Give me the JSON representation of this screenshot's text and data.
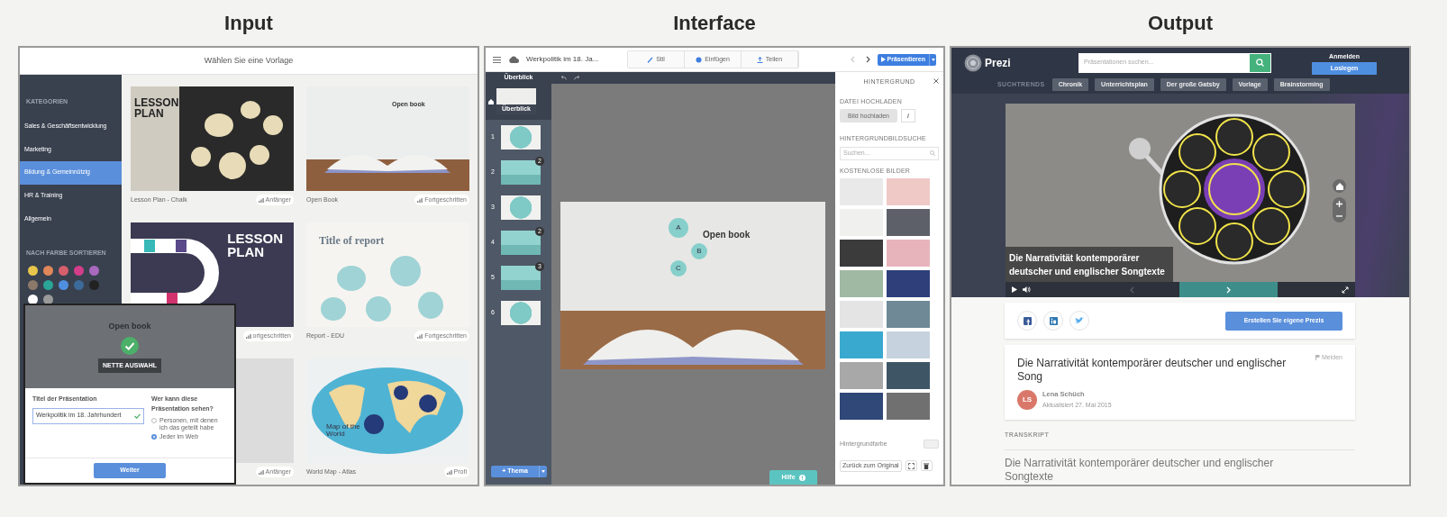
{
  "input": {
    "heading": "Input",
    "title": "Wählen Sie eine Vorlage",
    "categories_heading": "KATEGORIEN",
    "categories": [
      {
        "label": "Sales & Geschäftsentwicklung",
        "selected": false
      },
      {
        "label": "Marketing",
        "selected": false
      },
      {
        "label": "Bildung & Gemeinnützig",
        "selected": true
      },
      {
        "label": "HR & Training",
        "selected": false
      },
      {
        "label": "Allgemein",
        "selected": false
      }
    ],
    "color_heading": "NACH FARBE SORTIEREN",
    "colors": [
      {
        "color": "#e8c64b"
      },
      {
        "color": "#e0875a"
      },
      {
        "color": "#d65f6b"
      },
      {
        "color": "#d33d8a"
      },
      {
        "color": "#a869bf"
      },
      {
        "color": "#8b7869"
      },
      {
        "color": "#2aa598"
      },
      {
        "color": "#4f8fe0"
      },
      {
        "color": "#3c6a99"
      },
      {
        "color": "#222222"
      },
      {
        "color": "#ffffff"
      },
      {
        "color": "#9a9a9a"
      }
    ],
    "template_rows": [
      {
        "templates": [
          {
            "kind": "chalk",
            "preview_text": "LESSON PLAN",
            "name": "Lesson Plan - Chalk",
            "level": "Anfänger"
          },
          {
            "kind": "book",
            "preview_text": "Open book",
            "name": "Open Book",
            "level": "Fortgeschritten"
          }
        ]
      },
      {
        "templates": [
          {
            "kind": "board",
            "preview_text": "LESSON PLAN",
            "level": "ortgeschritten"
          },
          {
            "kind": "report",
            "preview_text": "Title of report",
            "name": "Report - EDU",
            "level": "Fortgeschritten"
          }
        ]
      },
      {
        "templates": [
          {
            "kind": "blank",
            "level": "Anfänger"
          },
          {
            "kind": "map",
            "preview_text": "Map of the World",
            "name": "World Map - Atlas",
            "level": "Profi"
          }
        ]
      }
    ],
    "dialog": {
      "preview_text": "Open book",
      "tag": "NETTE AUSWAHL",
      "title_label": "Titel der Präsentation",
      "title_value": "Werkpolitik im 18. Jahrhundert",
      "visibility_label": "Wer kann diese Präsentation sehen?",
      "visibility_options": [
        {
          "label": "Personen, mit denen ich das geteilt habe",
          "selected": false
        },
        {
          "label": "Jeder im Web",
          "selected": true
        }
      ],
      "button": "Weiter"
    }
  },
  "interface": {
    "heading": "Interface",
    "title": "Werkpolitik im 18. Ja...",
    "tools": [
      {
        "kind": "style",
        "label": "Stil"
      },
      {
        "kind": "insert",
        "label": "Einfügen"
      },
      {
        "kind": "share",
        "label": "Teilen"
      }
    ],
    "present_button": "Präsentieren",
    "outline_heading": "Überblick",
    "overview": {
      "label": "Überblick",
      "selected": true
    },
    "slides": [
      {
        "number": "1",
        "kind": "circle",
        "selected": false
      },
      {
        "number": "2",
        "kind": "teal",
        "badge": "2",
        "selected": false
      },
      {
        "number": "3",
        "kind": "circle",
        "selected": false
      },
      {
        "number": "4",
        "kind": "teal",
        "badge": "2",
        "selected": false
      },
      {
        "number": "5",
        "kind": "teal",
        "badge": "3",
        "selected": false
      },
      {
        "number": "6",
        "kind": "circle",
        "selected": false
      }
    ],
    "theme_button": "+ Thema",
    "canvas": {
      "title": "Open book",
      "letters": [
        "A",
        "B",
        "C"
      ]
    },
    "help_button": "Hilfe",
    "background_panel": {
      "title": "HINTERGRUND",
      "upload_heading": "DATEI HOCHLADEN",
      "upload_button": "Bild hochladen",
      "info_button": "i",
      "search_heading": "HINTERGRUNDBILDSUCHE",
      "search_placeholder": "Suchen...",
      "free_heading": "KOSTENLOSE BILDER",
      "color_label": "Hintergrundfarbe",
      "reset_button": "Zurück zum Original"
    }
  },
  "output": {
    "heading": "Output",
    "brand": "Prezi",
    "search_placeholder": "Präsentationen suchen...",
    "login": "Anmelden",
    "start_button": "Loslegen",
    "trends_label": "SUCHTRENDS",
    "trends": [
      "Chronik",
      "Unterrichtsplan",
      "Der große Gatsby",
      "Vorlage",
      "Brainstorming"
    ],
    "slide_title": "Die Narrativität kontemporärer deutscher und englischer Songtexte",
    "cta_button": "Erstellen Sie eigene Prezis",
    "report": "Melden",
    "title": "Die Narrativität kontemporärer deutscher und englischer Song",
    "author_initials": "LS",
    "author": "Lena Schüch",
    "updated": "Aktualisiert 27. Mai 2015",
    "transcript_label": "TRANSKRIPT",
    "transcript": "Die Narrativität kontemporärer deutscher und englischer Songtexte"
  }
}
